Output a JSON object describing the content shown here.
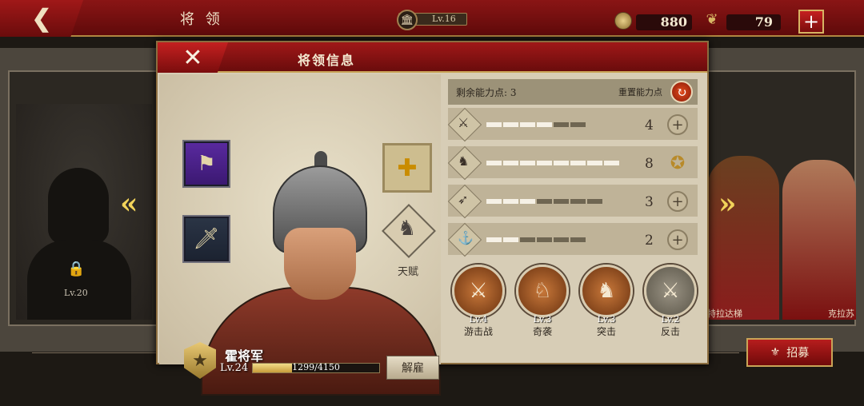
{
  "topbar": {
    "title": "将 领",
    "level": "Lv.16",
    "level_progress": 0.12,
    "coins": "880",
    "laurels": "79",
    "back_icon": "back-arrow-icon",
    "add_icon": "plus-icon"
  },
  "background": {
    "locked_lv": "Lv.20",
    "hero_right_1": "特拉达梯",
    "hero_right_2": "克拉苏",
    "recruit_label": "招募"
  },
  "modal": {
    "title": "将领信息",
    "talent_label": "天赋",
    "hero": {
      "name": "霍将军",
      "level": "Lv.24",
      "xp_text": "1299/4150",
      "xp_progress": 0.313,
      "dismiss_label": "解雇"
    },
    "points": {
      "label": "剩余能力点: 3",
      "reset_label": "重置能力点"
    },
    "stats": [
      {
        "name": "sword",
        "value": "4",
        "filled": 4,
        "total": 6,
        "action": "plus"
      },
      {
        "name": "horse",
        "value": "8",
        "filled": 8,
        "total": 8,
        "action": "max"
      },
      {
        "name": "bow",
        "value": "3",
        "filled": 3,
        "total": 7,
        "action": "plus"
      },
      {
        "name": "anchor",
        "value": "2",
        "filled": 2,
        "total": 6,
        "action": "plus"
      }
    ],
    "skills": [
      {
        "lv": "Lv.4",
        "name": "游击战",
        "active": true
      },
      {
        "lv": "Lv.3",
        "name": "奇袭",
        "active": true
      },
      {
        "lv": "Lv.3",
        "name": "突击",
        "active": true
      },
      {
        "lv": "Lv.2",
        "name": "反击",
        "active": false
      }
    ]
  }
}
